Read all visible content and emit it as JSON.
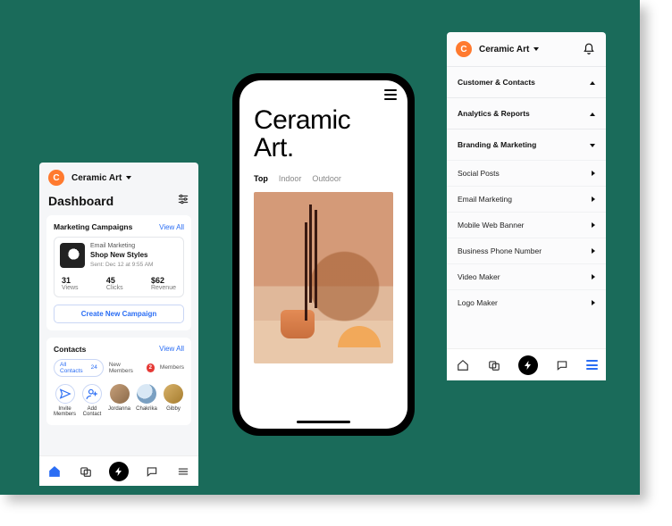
{
  "site_name": "Ceramic Art",
  "left": {
    "title": "Dashboard",
    "campaigns": {
      "header": "Marketing Campaigns",
      "view_all": "View All",
      "item": {
        "type": "Email Marketing",
        "name": "Shop New Styles",
        "sent": "Sent: Dec 12 at 9:55 AM",
        "stats": {
          "views_val": "31",
          "views_lbl": "Views",
          "clicks_val": "45",
          "clicks_lbl": "Clicks",
          "rev_val": "$62",
          "rev_lbl": "Revenue"
        }
      },
      "create_btn": "Create New Campaign"
    },
    "contacts": {
      "header": "Contacts",
      "view_all": "View All",
      "pills": {
        "all_label": "All Contacts",
        "all_count": "24",
        "new_label": "New Members",
        "new_count": "2",
        "members_label": "Members"
      },
      "items": {
        "invite": "Invite\nMembers",
        "add": "Add\nContact",
        "c1": "Jordanna",
        "c2": "Chakrika",
        "c3": "Gibby"
      }
    }
  },
  "center": {
    "title": "Ceramic Art.",
    "tabs": {
      "t1": "Top",
      "t2": "Indoor",
      "t3": "Outdoor"
    }
  },
  "right": {
    "sections": {
      "s1": "Customer & Contacts",
      "s2": "Analytics & Reports",
      "s3": "Branding & Marketing"
    },
    "menu": {
      "m1": "Social Posts",
      "m2": "Email Marketing",
      "m3": "Mobile Web Banner",
      "m4": "Business Phone Number",
      "m5": "Video Maker",
      "m6": "Logo Maker"
    }
  }
}
